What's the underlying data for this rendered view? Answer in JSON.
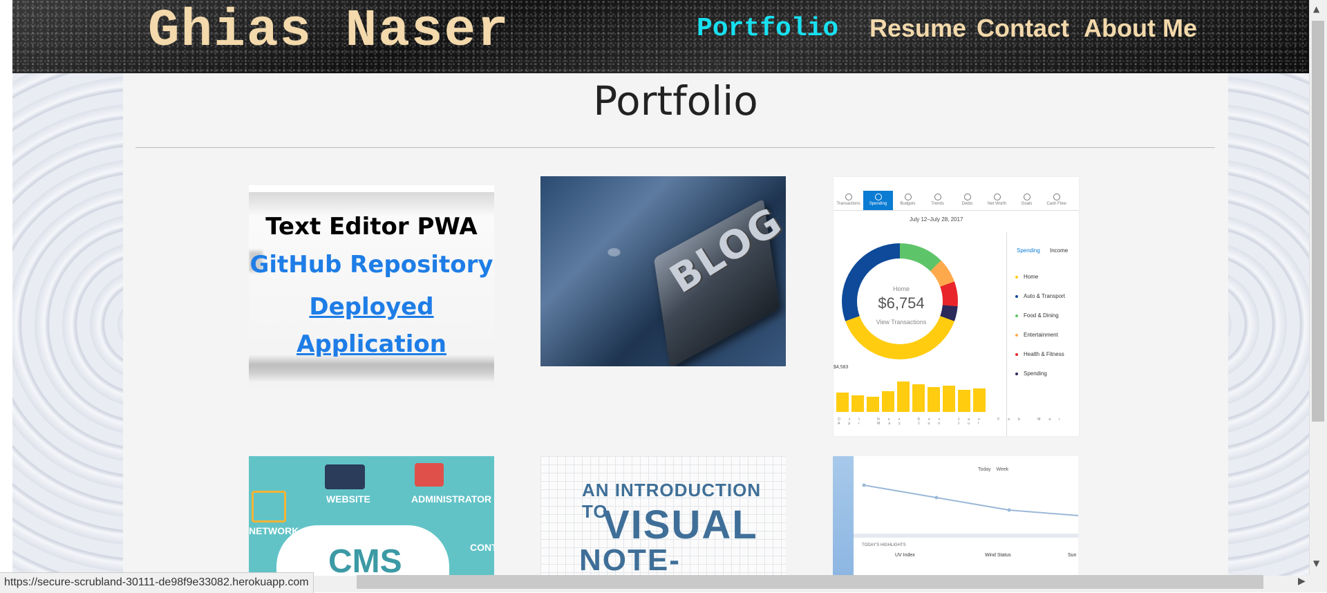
{
  "header": {
    "brand": "Ghias Naser",
    "nav": [
      {
        "label": "Portfolio",
        "active": true,
        "color": "#18e0f0"
      },
      {
        "label": "Resume"
      },
      {
        "label": "Contact"
      },
      {
        "label": "About Me"
      }
    ],
    "nav_color": "#f3d9ab"
  },
  "main": {
    "title": "Portfolio",
    "cards": [
      {
        "title": "Text Editor PWA",
        "links": [
          "GitHub Repository",
          "Deployed",
          "Application"
        ]
      },
      {
        "image_text": "BLOG"
      },
      {
        "tabs": [
          "Transactions",
          "Spending",
          "Budgets",
          "Trends",
          "Debts",
          "Net Worth",
          "Goals",
          "Cash Flow"
        ],
        "date_range": "July 12–July 28, 2017",
        "donut_label": "Home",
        "donut_amount": "$6,754",
        "donut_link": "View Transactions",
        "side_tabs": [
          "Spending",
          "Income"
        ],
        "categories": [
          "Home",
          "Auto & Transport",
          "Food & Dining",
          "Entertainment",
          "Health & Fitness",
          "Spending"
        ],
        "bar_label": "$4,583",
        "months": [
          "Oct",
          "Nov",
          "Dec",
          "Jan",
          "Feb",
          "Mar",
          "Apr",
          "May",
          "Jun",
          "Jul"
        ]
      },
      {
        "labels": [
          "WEBSITE",
          "ADMINISTRATOR",
          "NETWORK",
          "CMS",
          "CONT"
        ]
      },
      {
        "lines": [
          "AN INTRODUCTION TO",
          "VISUAL",
          "NOTE-TAKING"
        ]
      },
      {
        "tabs": [
          "Today",
          "Week"
        ],
        "highlights_label": "TODAY'S HIGHLIGHTS",
        "metrics": [
          "UV Index",
          "Wind Status",
          "Sun"
        ]
      }
    ]
  },
  "status_bar": {
    "url": "https://secure-scrubland-30111-de98f9e33082.herokuapp.com"
  }
}
